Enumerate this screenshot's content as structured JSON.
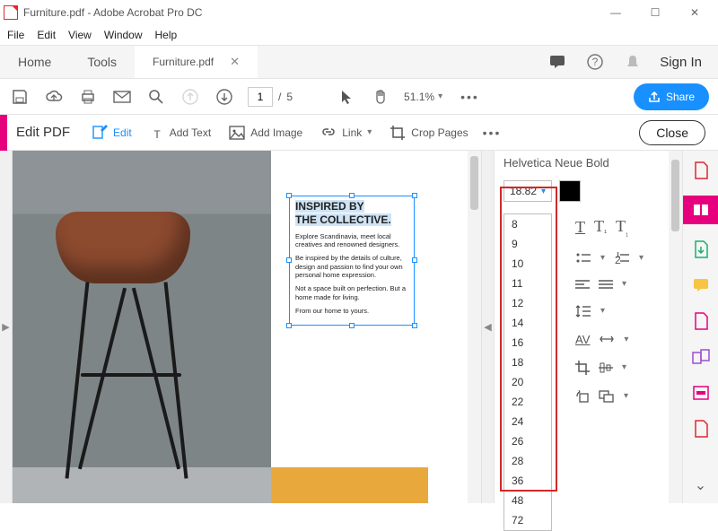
{
  "window": {
    "title": "Furniture.pdf - Adobe Acrobat Pro DC",
    "min": "—",
    "max": "☐",
    "close": "✕"
  },
  "menu": {
    "file": "File",
    "edit": "Edit",
    "view": "View",
    "window": "Window",
    "help": "Help"
  },
  "tabs": {
    "home": "Home",
    "tools": "Tools",
    "doc": "Furniture.pdf",
    "signin": "Sign In"
  },
  "tb1": {
    "page_current": "1",
    "page_sep": "/",
    "page_total": "5",
    "zoom": "51.1%",
    "share": "Share"
  },
  "tb2": {
    "title": "Edit PDF",
    "edit": "Edit",
    "addtext": "Add Text",
    "addimage": "Add Image",
    "link": "Link",
    "crop": "Crop Pages",
    "close": "Close"
  },
  "doc": {
    "hd1": "INSPIRED BY",
    "hd2": "THE COLLECTIVE.",
    "p1": "Explore Scandinavia, meet local creatives and renowned designers.",
    "p2": "Be inspired by the details of culture, design and passion to find your own personal home expression.",
    "p3": "Not a space built on perfection. But a home made for living.",
    "p4": "From our home to yours."
  },
  "format": {
    "font": "Helvetica Neue Bold",
    "size": "18.82",
    "sizes": [
      "8",
      "9",
      "10",
      "11",
      "12",
      "14",
      "16",
      "18",
      "20",
      "22",
      "24",
      "26",
      "28",
      "36",
      "48",
      "72"
    ],
    "av": "AV"
  }
}
